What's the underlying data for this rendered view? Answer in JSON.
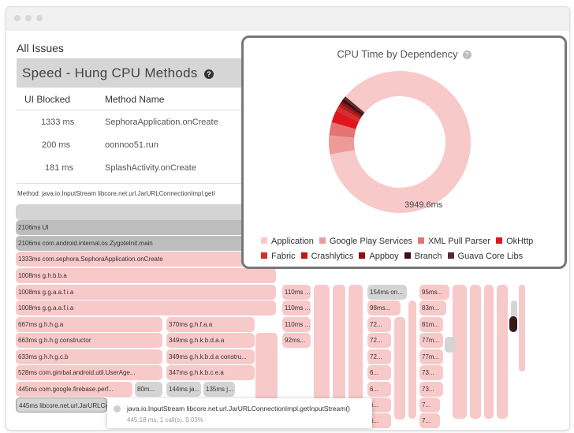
{
  "section_title": "All Issues",
  "speed_header": {
    "title": "Speed - Hung CPU Methods",
    "help": "?"
  },
  "table": {
    "headers": [
      "UI Blocked",
      "Method Name"
    ],
    "rows": [
      {
        "blocked": "1333 ms",
        "method": "SephoraApplication.onCreate"
      },
      {
        "blocked": "200 ms",
        "method": "oonnoo51.run"
      },
      {
        "blocked": "181 ms",
        "method": "SplashActivity.onCreate"
      }
    ]
  },
  "method_text": "Method: java.io.InputStream libcore.net.url.JarURLConnectionImpl.getI",
  "flame": {
    "col1": [
      "2106ms UI",
      "2106ms com.android.internal.os.ZygoteInit.main",
      "1333ms com.sephora.SephoraApplication.onCreate",
      "1008ms g.h.b.b.a",
      "1008ms g.g.a.a.f.i.a",
      "1008ms g.g.a.a.f.i.a",
      "667ms g.h.h.g.a",
      "663ms g.h.h.g constructor",
      "633ms g.h.h.g.c.b",
      "528ms com.gimbal.android.util.UserAge...",
      "445ms com.google.firebase.perf...",
      "445ms libcore.net.url.JarURLConnectionImpl..."
    ],
    "small_80": "80m...",
    "col2": [
      "370ms g.h.f.a.a",
      "349ms g.h.k.b.d.a.a",
      "349ms g.h.k.b.d.a constru...",
      "347ms g.h.k.b.c.e.a",
      "144ms ja...",
      "135ms j..."
    ],
    "col3": [
      "110ms ...",
      "110ms ...",
      "110ms ...",
      "92ms..."
    ],
    "col4": [
      "154ms on...",
      "98ms...",
      "72...",
      "72...",
      "72...",
      "6...",
      "6...",
      "6...",
      "6..."
    ],
    "col5": [
      "95ms...",
      "83m...",
      "81m...",
      "77m...",
      "77m...",
      "73...",
      "73...",
      "7...",
      "7..."
    ]
  },
  "tooltip": {
    "title": "java.io.InputStream libcore.net.url.JarURLConnectionImpl.getInputStream()",
    "sub": "445.18 ms, 1 call(s), 9.03%"
  },
  "cpu_panel": {
    "title": "CPU Time by Dependency",
    "help": "?",
    "center_value": "3949.6ms",
    "legend": [
      {
        "name": "Application",
        "color": "#f8c9c9"
      },
      {
        "name": "Google Play Services",
        "color": "#ef9a9a"
      },
      {
        "name": "XML Pull Parser",
        "color": "#e57373"
      },
      {
        "name": "OkHttp",
        "color": "#e0161e"
      },
      {
        "name": "Fabric",
        "color": "#d32f2f"
      },
      {
        "name": "Crashlytics",
        "color": "#b71c1c"
      },
      {
        "name": "Appboy",
        "color": "#8b0f14"
      },
      {
        "name": "Branch",
        "color": "#3e0d0d"
      },
      {
        "name": "Guava Core Libs",
        "color": "#5d2a2a"
      }
    ],
    "slice_values": [
      3400,
      170,
      120,
      110,
      40,
      30,
      25,
      30,
      24.6
    ]
  }
}
